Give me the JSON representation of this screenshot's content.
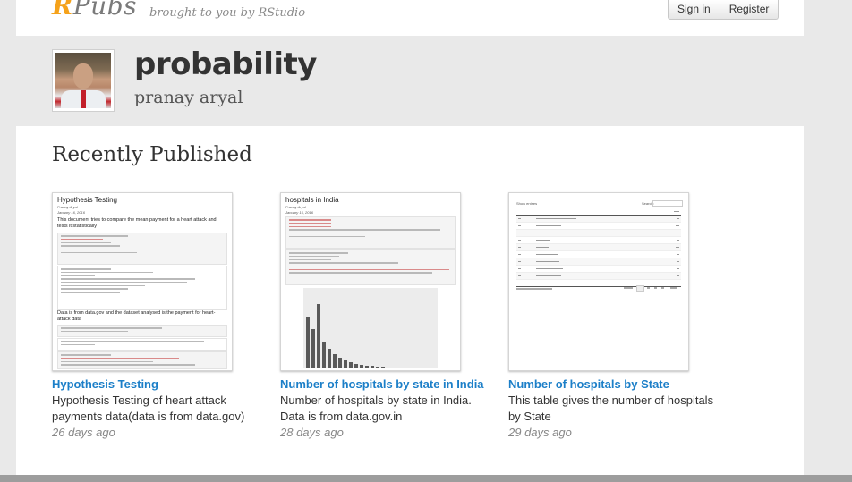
{
  "brand": {
    "logo_r": "R",
    "logo_rest": "Pubs",
    "tagline": "brought to you by RStudio"
  },
  "auth": {
    "sign_in": "Sign in",
    "register": "Register"
  },
  "profile": {
    "title": "probability",
    "author": "pranay aryal"
  },
  "section": {
    "heading": "Recently Published"
  },
  "cards": [
    {
      "title": "Hypothesis Testing",
      "description": "Hypothesis Testing of heart attack payments data(data is from data.gov)",
      "date": "26 days ago",
      "thumb": {
        "heading": "Hypothesis Testing",
        "author": "Pranay Aryal",
        "date": "January 16, 2016",
        "intro": "This document tries to compare the mean payment for a heart attack and tests it statistically",
        "note": "Data is from data.gov and the dataset analysed is the payment for heart-attack data"
      }
    },
    {
      "title": "Number of hospitals by state in India",
      "description": "Number of hospitals by state in India. Data is from data.gov.in",
      "date": "28 days ago",
      "thumb": {
        "heading": "hospitals in India",
        "author": "Pranay Aryal",
        "date": "January 16, 2016"
      }
    },
    {
      "title": "Number of hospitals by State",
      "description": "This table gives the number of hospitals by State",
      "date": "29 days ago",
      "thumb": {
        "show": "Show",
        "entries": "entries",
        "search": "Search:"
      }
    }
  ],
  "colors": {
    "accent": "#f5a21b",
    "link": "#1c7fc8",
    "background": "#e9e9e9"
  }
}
